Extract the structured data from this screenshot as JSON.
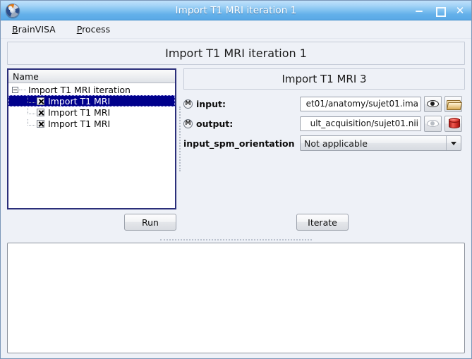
{
  "window": {
    "title": "Import T1 MRI iteration 1",
    "app_icon": "brainvisa-logo-icon",
    "controls": {
      "minimize": "minimize-icon",
      "maximize": "maximize-icon",
      "close": "close-icon"
    }
  },
  "menubar": {
    "items": [
      {
        "label": "BrainVISA",
        "mnemonic": "B",
        "rest": "rainVISA"
      },
      {
        "label": "Process",
        "mnemonic": "P",
        "rest": "rocess"
      }
    ]
  },
  "banner": {
    "title": "Import T1 MRI iteration 1"
  },
  "tree": {
    "column_header": "Name",
    "root": {
      "label": "Import T1 MRI iteration",
      "expander": "collapse-minus-icon"
    },
    "children": [
      {
        "label": "Import T1 MRI",
        "checked": true,
        "selected": true
      },
      {
        "label": "Import T1 MRI",
        "checked": true,
        "selected": false
      },
      {
        "label": "Import T1 MRI",
        "checked": true,
        "selected": false
      }
    ]
  },
  "params": {
    "title": "Import T1 MRI 3",
    "rows": [
      {
        "label": "input:",
        "mandatory": "M",
        "value": "et01/anatomy/sujet01.ima",
        "view_icon": "eye-icon",
        "view_enabled": true,
        "action_icon": "folder-icon"
      },
      {
        "label": "output:",
        "mandatory": "M",
        "value": "ult_acquisition/sujet01.nii",
        "view_icon": "eye-icon",
        "view_enabled": false,
        "action_icon": "database-icon"
      }
    ],
    "orientation": {
      "label": "input_spm_orientation",
      "value": "Not applicable",
      "arrow_icon": "chevron-down-icon"
    }
  },
  "buttons": {
    "run": "Run",
    "iterate": "Iterate"
  },
  "log": {
    "content": ""
  },
  "colors": {
    "titlebar_top": "#bfe0fa",
    "titlebar_bottom": "#5aa9e6",
    "window_bg": "#eef1f7",
    "tree_focus_border": "#2b2f7a",
    "selection": "#00008b",
    "database_red": "#cf2a22",
    "folder_tan": "#e0bc72"
  }
}
